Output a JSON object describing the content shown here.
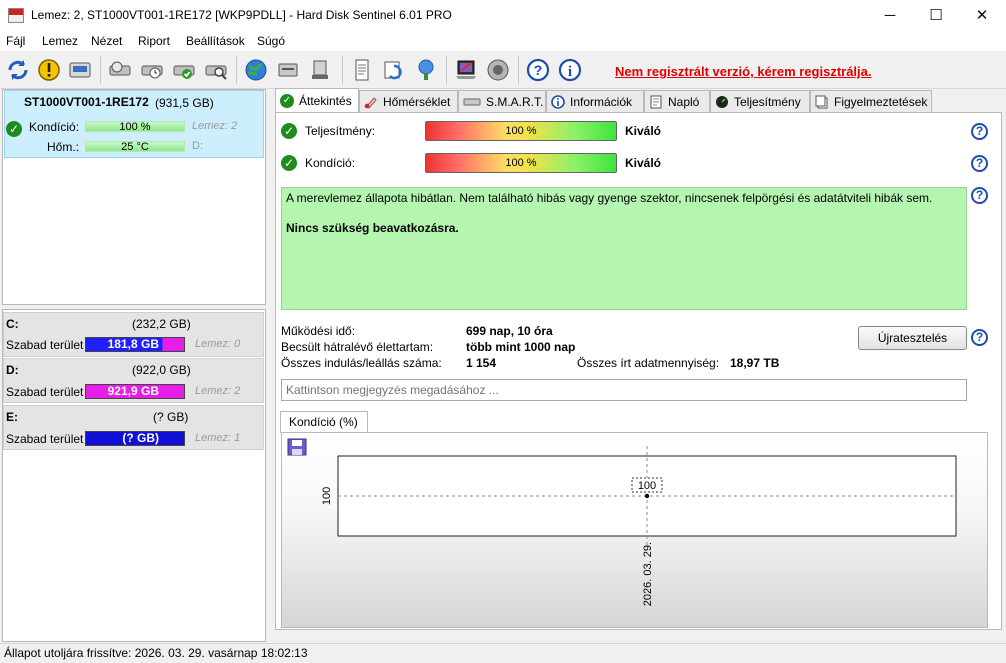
{
  "window": {
    "title": "Lemez: 2, ST1000VT001-1RE172 [WKP9PDLL]  -  Hard Disk Sentinel 6.01 PRO",
    "minimize": "─",
    "maximize": "☐",
    "close": "✕"
  },
  "menu": [
    "Fájl",
    "Lemez",
    "Nézet",
    "Riport",
    "Beállítások",
    "Súgó"
  ],
  "toolbar": {
    "icons": [
      "refresh-icon",
      "alert-icon",
      "disk-icon",
      "disk-test-icon",
      "disk-time-icon",
      "disk-check-icon",
      "disk-search-icon",
      "globe-icon",
      "server-icon",
      "network-drive-icon",
      "report-icon",
      "sync-icon",
      "network-icon",
      "laptop-icon",
      "speaker-icon",
      "help-icon",
      "info-icon"
    ],
    "registration_text": "Nem regisztrált verzió, kérem regisztrálja."
  },
  "disk": {
    "name": "ST1000VT001-1RE172",
    "size": "(931,5 GB)",
    "health_label": "Kondíció:",
    "health_value": "100 %",
    "health_percent": 100,
    "disk_ref": "Lemez: 2",
    "temp_label": "Hőm.:",
    "temp_value": "25 °C",
    "drive_letter": "D:"
  },
  "partitions": [
    {
      "letter": "C:",
      "size": "(232,2 GB)",
      "free_label": "Szabad terület",
      "free_value": "181,8 GB",
      "disk_ref": "Lemez: 0",
      "color": "#2020ff",
      "fill": 0.78
    },
    {
      "letter": "D:",
      "size": "(922,0 GB)",
      "free_label": "Szabad terület",
      "free_value": "921,9 GB",
      "disk_ref": "Lemez: 2",
      "color": "#e61ee6",
      "fill": 1.0
    },
    {
      "letter": "E:",
      "size": "(? GB)",
      "free_label": "Szabad terület",
      "free_value": "(? GB)",
      "disk_ref": "Lemez: 1",
      "color": "#1010d8",
      "fill": 1.0
    }
  ],
  "tabs": [
    "Áttekintés",
    "Hőmérséklet",
    "S.M.A.R.T.",
    "Információk",
    "Napló",
    "Teljesítmény",
    "Figyelmeztetések"
  ],
  "overview": {
    "performance_label": "Teljesítmény:",
    "performance_value": "100 %",
    "performance_percent": 100,
    "performance_rating": "Kiváló",
    "condition_label": "Kondíció:",
    "condition_value": "100 %",
    "condition_percent": 100,
    "condition_rating": "Kiváló",
    "status_message": "A merevlemez állapota hibátlan. Nem található hibás vagy gyenge szektor, nincsenek felpörgési és adatátviteli hibák sem.",
    "status_action": "Nincs szükség beavatkozásra.",
    "uptime_label": "Működési idő:",
    "uptime_value": "699 nap, 10 óra",
    "remaining_label": "Becsült hátralévő élettartam:",
    "remaining_value": "több mint 1000 nap",
    "startstop_label": "Összes indulás/leállás száma:",
    "startstop_value": "1 154",
    "written_label": "Összes írt adatmennyiség:",
    "written_value": "18,97 TB",
    "restart_button": "Újratesztelés",
    "note_placeholder": "Kattintson megjegyzés megadásához ..."
  },
  "chart_tab": "Kondíció  (%)",
  "chart_data": {
    "type": "line",
    "x": [
      "2026. 03. 29."
    ],
    "series": [
      {
        "values": [
          100
        ]
      }
    ],
    "data_labels": [
      "100"
    ],
    "y_ticks": [
      "100"
    ],
    "x_ticks": [
      "2026. 03. 29."
    ],
    "grid": true
  },
  "statusbar": {
    "text": "Állapot utoljára frissítve: 2026. 03. 29. vasárnap 18:02:13"
  }
}
